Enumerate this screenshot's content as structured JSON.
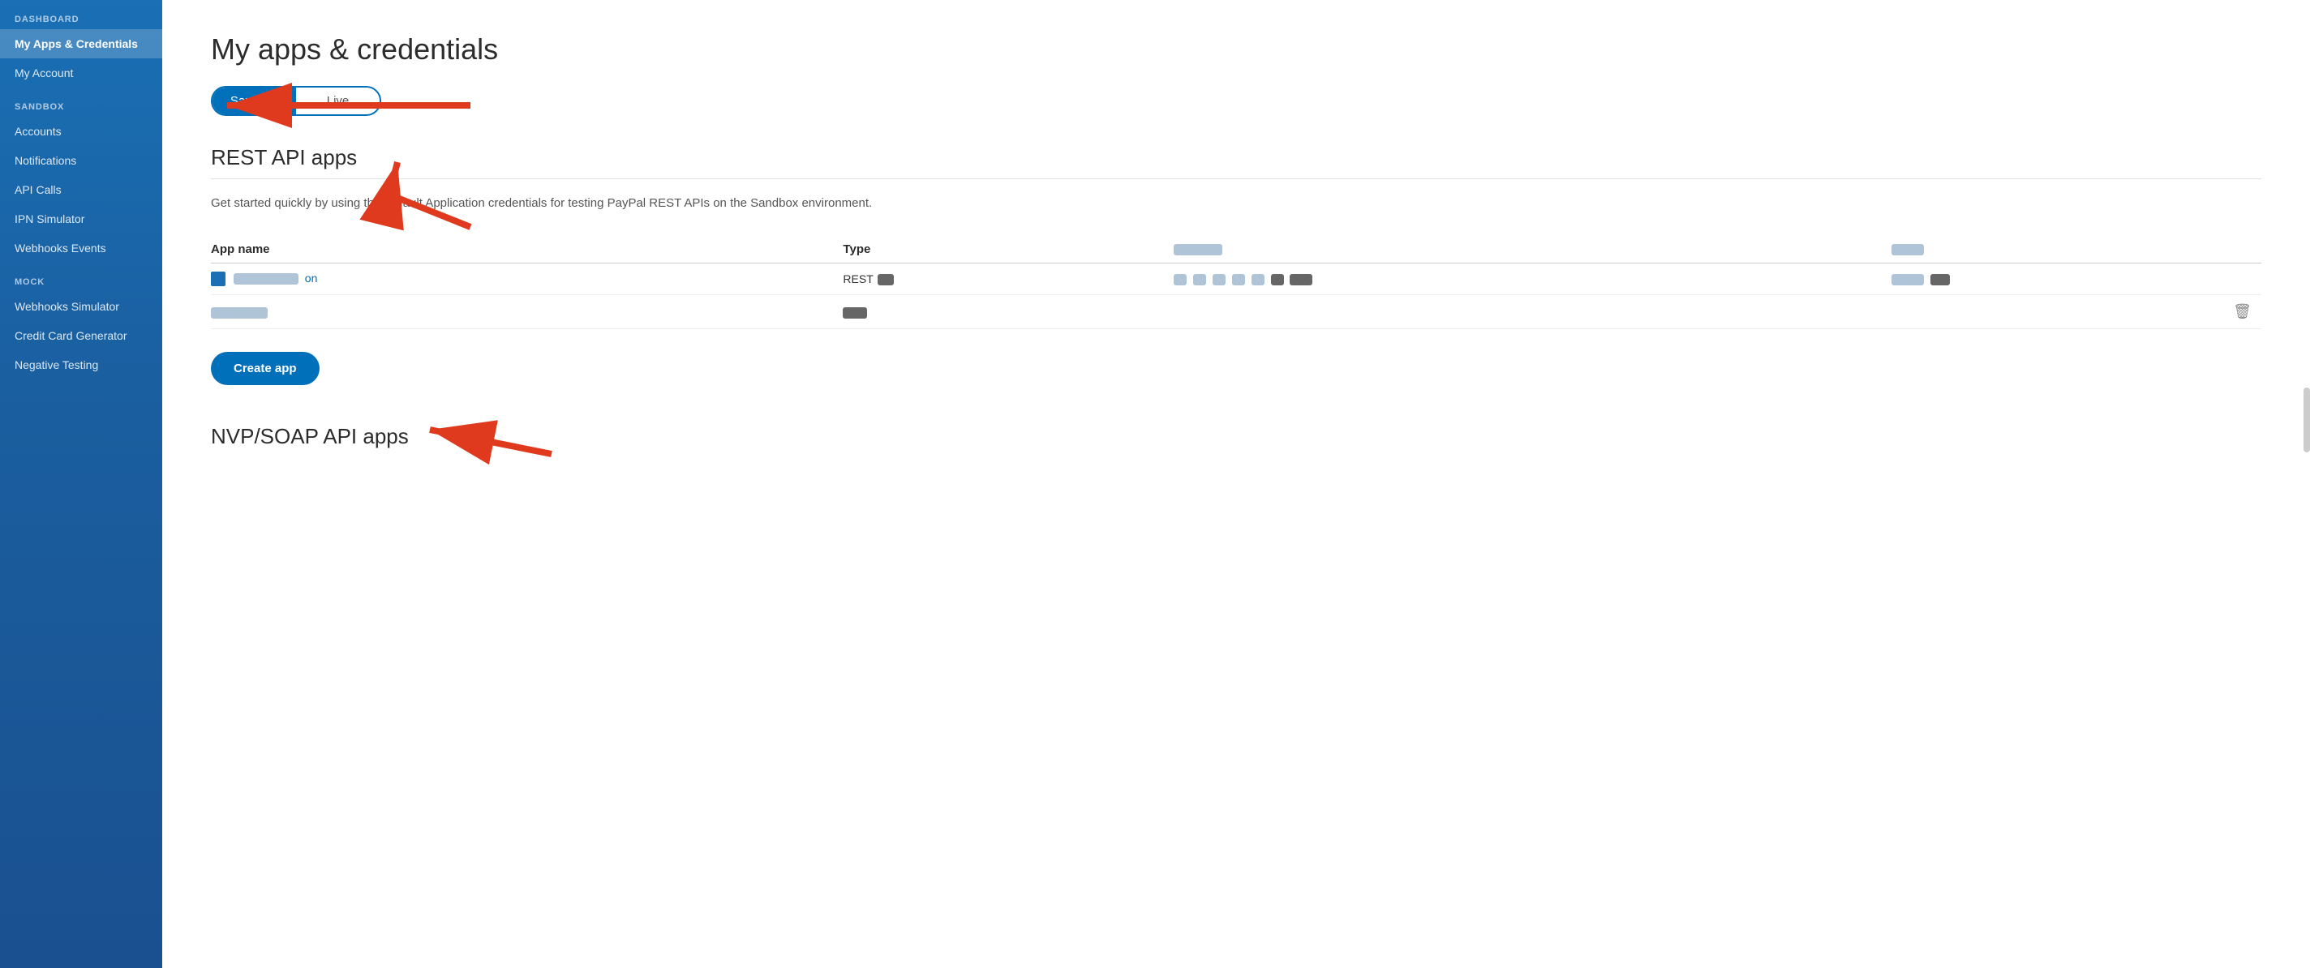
{
  "sidebar": {
    "sections": [
      {
        "label": "DASHBOARD",
        "items": [
          {
            "id": "my-apps",
            "text": "My Apps & Credentials",
            "active": true
          },
          {
            "id": "my-account",
            "text": "My Account",
            "active": false
          }
        ]
      },
      {
        "label": "SANDBOX",
        "items": [
          {
            "id": "accounts",
            "text": "Accounts",
            "active": false
          },
          {
            "id": "notifications",
            "text": "Notifications",
            "active": false
          },
          {
            "id": "api-calls",
            "text": "API Calls",
            "active": false
          },
          {
            "id": "ipn-simulator",
            "text": "IPN Simulator",
            "active": false
          },
          {
            "id": "webhooks-events",
            "text": "Webhooks Events",
            "active": false
          }
        ]
      },
      {
        "label": "MOCK",
        "items": [
          {
            "id": "webhooks-simulator",
            "text": "Webhooks Simulator",
            "active": false
          },
          {
            "id": "credit-card-generator",
            "text": "Credit Card Generator",
            "active": false
          },
          {
            "id": "negative-testing",
            "text": "Negative Testing",
            "active": false
          }
        ]
      }
    ]
  },
  "main": {
    "page_title": "My apps & credentials",
    "tabs": [
      {
        "id": "sandbox",
        "label": "Sandbox",
        "active": true
      },
      {
        "id": "live",
        "label": "Live",
        "active": false
      }
    ],
    "rest_api": {
      "title": "REST API apps",
      "description": "Get started quickly by using the Default Application credentials for testing PayPal REST APIs on the Sandbox environment.",
      "table": {
        "headers": [
          "App name",
          "Type",
          "",
          ""
        ],
        "rows": [
          {
            "name_prefix": "",
            "name_blurred": true,
            "type": "REST",
            "cols_blurred": true,
            "deletable": false
          },
          {
            "name_blurred": true,
            "type_blurred": true,
            "cols_blurred": false,
            "deletable": true
          }
        ]
      },
      "create_btn": "Create app"
    },
    "nvp_soap": {
      "title": "NVP/SOAP API apps"
    }
  }
}
